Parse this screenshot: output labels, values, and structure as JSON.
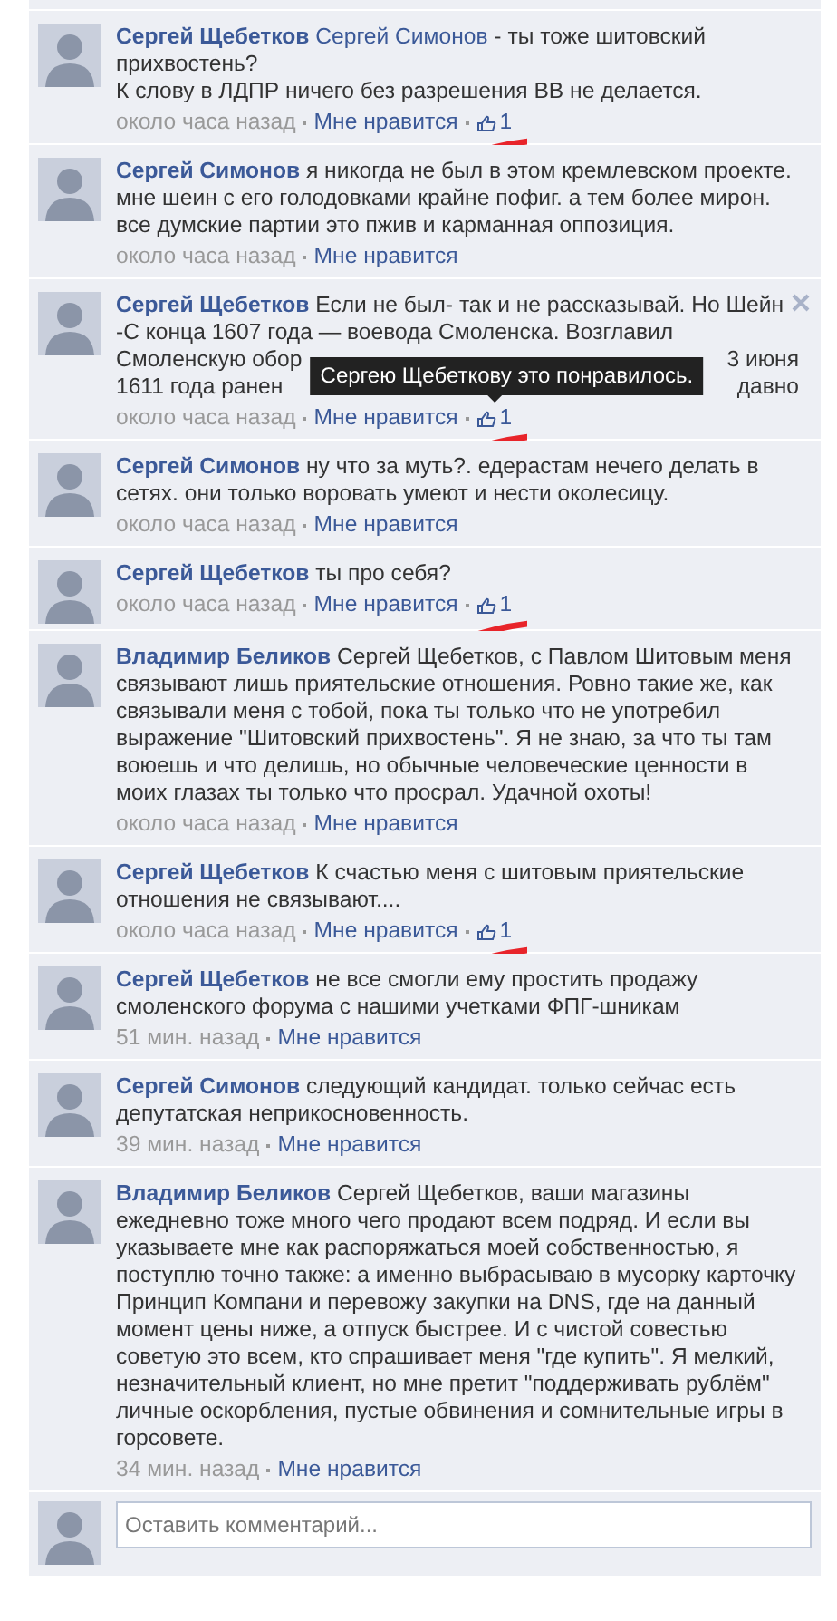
{
  "comments": [
    {
      "author": "Сергей Щебетков",
      "mention": "Сергей Симонов",
      "text": " - ты тоже шитовский прихвостень?\nК слову в ЛДПР ничего без разрешения ВВ не делается.",
      "time": "около часа назад",
      "like_label": "Мне нравится",
      "likes": "1",
      "marked": true,
      "hovered": false
    },
    {
      "author": "Сергей Симонов",
      "text": "я никогда не был в этом кремлевском проекте. мне шеин с его голодовками крайне пофиг. а тем более мирон. все думские партии это пжив и карманная оппозиция.",
      "time": "около часа назад",
      "like_label": "Мне нравится",
      "marked": false,
      "hovered": false
    },
    {
      "author": "Сергей Щебетков",
      "text": "Если не был- так и не рассказывай. Но Шейн -С конца 1607 года — воевода Смоленска. Возглавил",
      "covered_lines": [
        {
          "left": "Смоленскую обор",
          "right": "3 июня"
        },
        {
          "left": "1611 года ранен",
          "right": "давно"
        }
      ],
      "time": "около часа назад",
      "like_label": "Мне нравится",
      "likes": "1",
      "tooltip": "Сергею Щебеткову это понравилось.",
      "marked": true,
      "hovered": true
    },
    {
      "author": "Сергей Симонов",
      "text": "ну что за муть?. едерастам нечего делать в сетях. они только воровать умеют и нести околесицу.",
      "time": "около часа назад",
      "like_label": "Мне нравится",
      "marked": false,
      "hovered": false
    },
    {
      "author": "Сергей Щебетков",
      "text": "ты про себя?",
      "time": "около часа назад",
      "like_label": "Мне нравится",
      "likes": "1",
      "marked": true,
      "hovered": false
    },
    {
      "author": "Владимир Беликов",
      "text": "Сергей Щебетков, с Павлом Шитовым меня связывают лишь приятельские отношения. Ровно такие же, как связывали меня с тобой, пока ты только что не употребил выражение \"Шитовский прихвостень\". Я не знаю, за что ты там воюешь и что делишь, но обычные человеческие ценности в моих глазах ты только что просрал. Удачной охоты!",
      "time": "около часа назад",
      "like_label": "Мне нравится",
      "marked": false,
      "hovered": false
    },
    {
      "author": "Сергей Щебетков",
      "text": "К счастью меня с шитовым приятельские отношения не связывают....",
      "time": "около часа назад",
      "like_label": "Мне нравится",
      "likes": "1",
      "marked": true,
      "hovered": false
    },
    {
      "author": "Сергей Щебетков",
      "text": "не все смогли ему простить продажу смоленского форума с нашими учетками ФПГ-шникам",
      "time": "51 мин. назад",
      "like_label": "Мне нравится",
      "marked": false,
      "hovered": false
    },
    {
      "author": "Сергей Симонов",
      "text": "следующий кандидат. только сейчас есть депутатская неприкосновенность.",
      "time": "39 мин. назад",
      "like_label": "Мне нравится",
      "marked": false,
      "hovered": false
    },
    {
      "author": "Владимир Беликов",
      "text": "Сергей Щебетков, ваши магазины ежедневно тоже много чего продают всем подряд. И если вы указываете мне как распоряжаться моей собственностью, я поступлю точно также: а именно выбрасываю в мусорку карточку Принцип Компани и перевожу закупки на DNS, где на данный момент цены ниже, а отпуск быстрее. И с чистой совестью советую это всем, кто спрашивает меня \"где купить\". Я мелкий, незначительный клиент, но мне претит \"поддерживать рублём\" личные оскорбления, пустые обвинения и сомнительные игры в горсовете.",
      "time": "34 мин. назад",
      "like_label": "Мне нравится",
      "marked": false,
      "hovered": false
    }
  ],
  "composer": {
    "placeholder": "Оставить комментарий..."
  }
}
